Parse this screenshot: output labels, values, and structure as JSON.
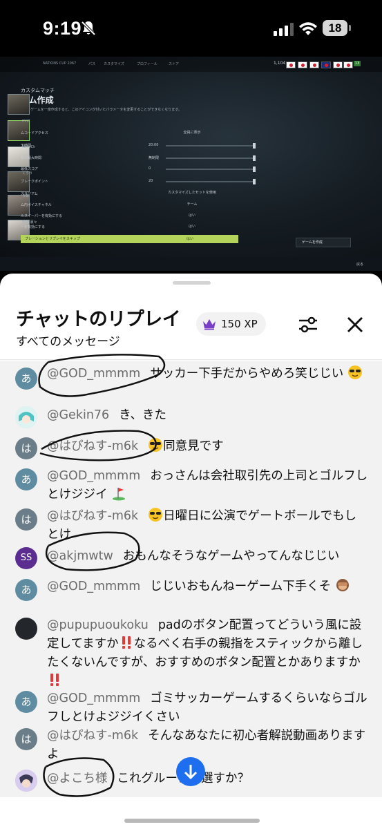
{
  "status_bar": {
    "time": "9:19",
    "battery": "18"
  },
  "video": {
    "nav": [
      "NATIONS CUP 2067",
      "パス",
      "カスタマイズ",
      "プロフィール",
      "ストア"
    ],
    "score": "1,104",
    "green_badge": "13",
    "header_small": "カスタムマッチ",
    "header_title": "ーム作成",
    "description": "ゲームを一度作成すると、このアイコンが付いたパラメータを変更することができなくなります。",
    "names": [
      "mnjt",
      "Gekin76",
      "NekoCh",
      "くろう",
      "りあ",
      "暗梯 裏々"
    ],
    "rows": [
      {
        "label": "ムコードアクセス",
        "value": ""
      },
      {
        "label": "チ時間",
        "value": "20:00"
      },
      {
        "label": "脱の最大時間",
        "value": "無制限"
      },
      {
        "label": "最低スコア",
        "value": "0"
      },
      {
        "label": "ブレークポイント",
        "value": "20"
      },
      {
        "label": "スタジアム",
        "value": ""
      },
      {
        "label": "ム内ボイスチャネル",
        "value": ""
      },
      {
        "label": "ルスイーパーを有効にする",
        "value": ""
      },
      {
        "label": "ーを有効にする",
        "value": ""
      }
    ],
    "center_labels": [
      "全員に表示",
      "カスタマイズしたセットを使用",
      "チーム",
      "はい",
      "はい",
      "はい"
    ],
    "highlight_row": "プレーションとリプレイをスキップ",
    "create_button": "ゲームを作成",
    "back_label": "戻る"
  },
  "chat": {
    "title": "チャットのリプレイ",
    "subtitle": "すべてのメッセージ",
    "xp_badge": "150 XP",
    "messages": [
      {
        "avatar": "あ",
        "avatar_color": "#5f8ca0",
        "author": "@GOD_mmmm",
        "text": "サッカー下手だからやめろ笑じじい"
      },
      {
        "avatar": "",
        "avatar_color": "#bfe6e6",
        "author": "@Gekin76",
        "text": "き、きた"
      },
      {
        "avatar": "は",
        "avatar_color": "#6a7d88",
        "author": "@はぴねす-m6k",
        "text": "同意見です"
      },
      {
        "avatar": "あ",
        "avatar_color": "#5f8ca0",
        "author": "@GOD_mmmm",
        "text": "おっさんは会社取引先の上司とゴルフしとけジジイ"
      },
      {
        "avatar": "は",
        "avatar_color": "#6a7d88",
        "author": "@はぴねす-m6k",
        "text": "日曜日に公演でゲートボールでもしとけ"
      },
      {
        "avatar": "SS",
        "avatar_color": "#5b2d91",
        "author": "@akjmwtw",
        "text": "おもんなそうなゲームやってんなじじい"
      },
      {
        "avatar": "あ",
        "avatar_color": "#5f8ca0",
        "author": "@GOD_mmmm",
        "text": "じじいおもんねーゲーム下手くそ"
      },
      {
        "avatar": "",
        "avatar_color": "#23262b",
        "author": "@pupupuoukoku",
        "text_a": "padのボタン配置ってどういう風に設定してますか",
        "text_b": "なるべく右手の親指をスティックから離したくないんですが、おすすめのボタン配置とかありますか"
      },
      {
        "avatar": "あ",
        "avatar_color": "#5f8ca0",
        "author": "@GOD_mmmm",
        "text": "ゴミサッカーゲームするくらいならゴルフしとけよジジイくさい"
      },
      {
        "avatar": "は",
        "avatar_color": "#6a7d88",
        "author": "@はぴねす-m6k",
        "text": "そんなあなたに初心者解説動画ありますよ"
      },
      {
        "avatar": "",
        "avatar_color": "#c9b6e4",
        "author": "@よこち様",
        "text": "これグループ予選すか？"
      }
    ]
  },
  "icons": {
    "bell": "bell-slash-icon",
    "signal": "cellular-signal-icon",
    "wifi": "wifi-icon",
    "crown": "crown-icon",
    "filter": "sliders-icon",
    "close": "close-icon",
    "scroll": "arrow-down-icon"
  }
}
